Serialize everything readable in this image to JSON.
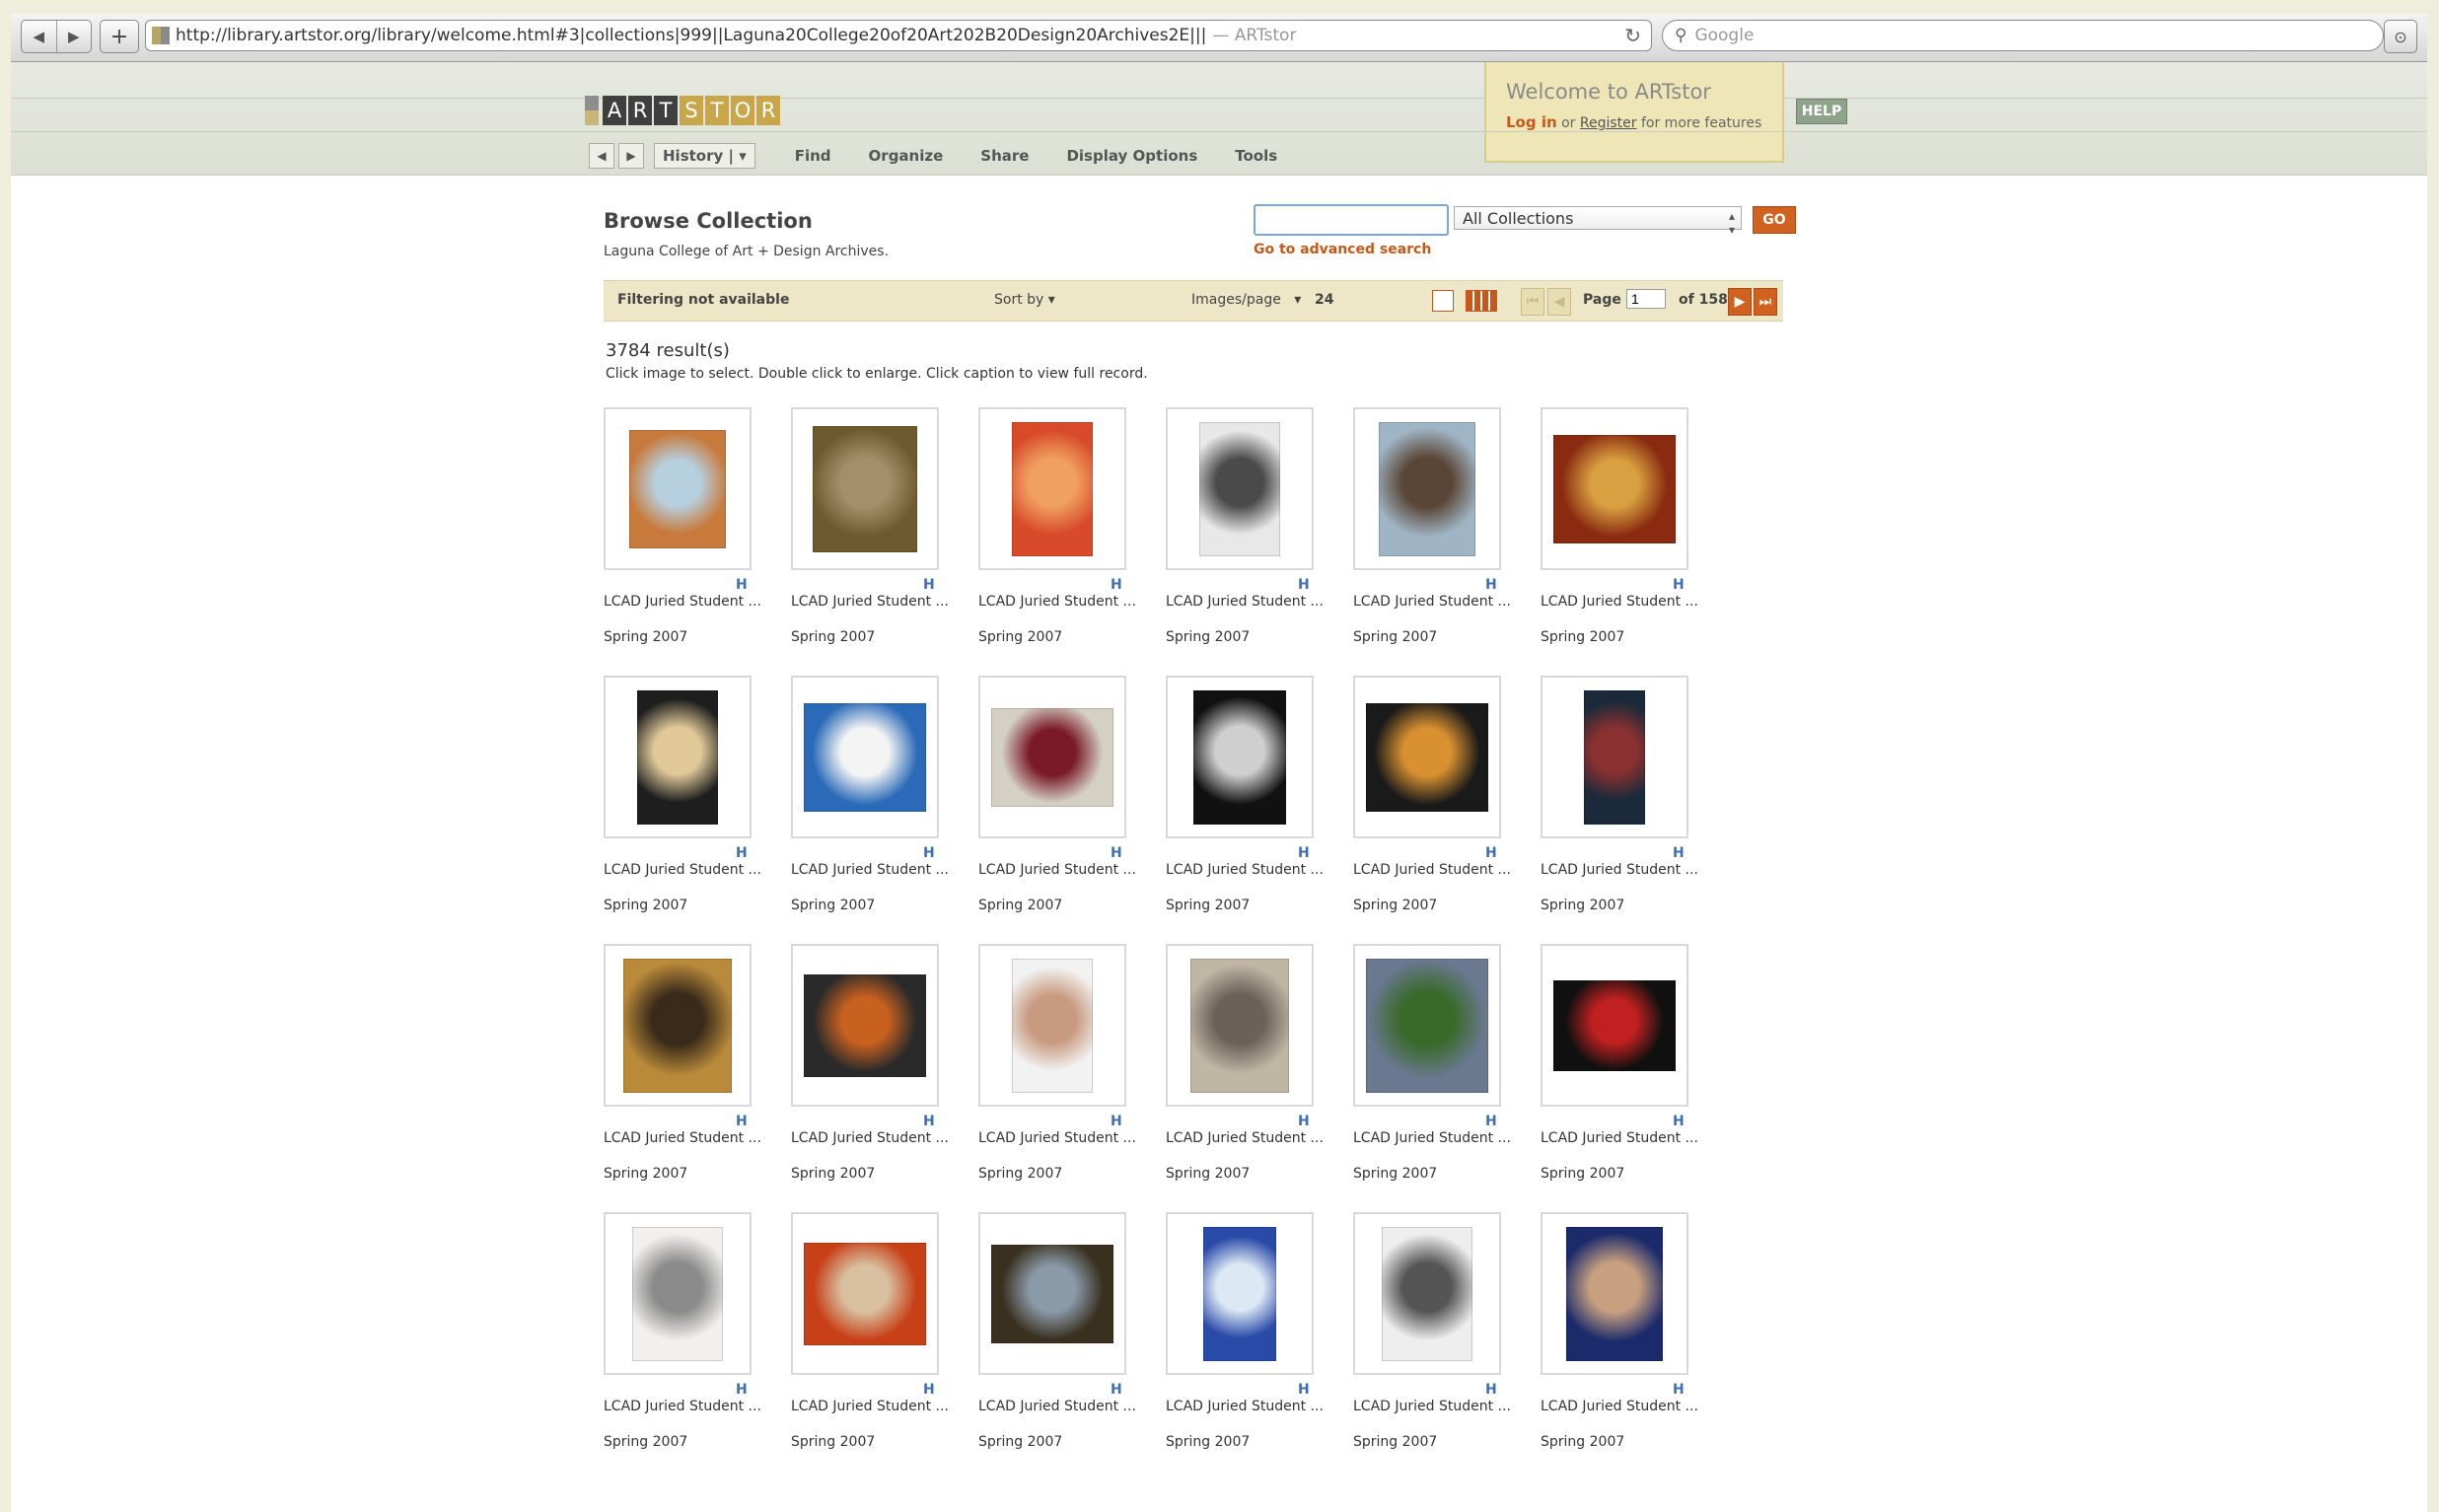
{
  "browser": {
    "url": "http://library.artstor.org/library/welcome.html#3|collections|999||Laguna20College20of20Art202B20Design20Archives2E|||",
    "page_title": "— ARTstor",
    "search_placeholder": "Google"
  },
  "header": {
    "logo_letters": [
      "A",
      "R",
      "T",
      "S",
      "T",
      "O",
      "R"
    ],
    "nav": {
      "history_label": "History",
      "menu": [
        "Find",
        "Organize",
        "Share",
        "Display Options",
        "Tools"
      ]
    },
    "welcome": {
      "title": "Welcome to ARTstor",
      "login": "Log in",
      "or": "or",
      "register": "Register",
      "suffix": "for more features"
    },
    "help_label": "HELP"
  },
  "browse": {
    "title": "Browse Collection",
    "subtitle": "Laguna College of Art + Design Archives.",
    "search": {
      "query": "",
      "collection": "All Collections",
      "go_label": "GO",
      "advanced_link": "Go to advanced search"
    }
  },
  "toolbar": {
    "filter": "Filtering not available",
    "sort_label": "Sort by",
    "ipp_label": "Images/page",
    "ipp_value": "24",
    "page_label": "Page",
    "page_value": "1",
    "of_label": "of 158"
  },
  "results": {
    "count": "3784 result(s)",
    "instructions": "Click image to select. Double click to enlarge. Click caption to view full record."
  },
  "items": [
    {
      "caption": "LCAD Juried Student ...",
      "date": "Spring 2007",
      "h": "H",
      "thumb": "framed-abstract",
      "colors": [
        "#c87a3c",
        "#b7d0e0"
      ]
    },
    {
      "caption": "LCAD Juried Student ...",
      "date": "Spring 2007",
      "h": "H",
      "thumb": "framed-portrait",
      "colors": [
        "#6e5a2e",
        "#a58f6a"
      ]
    },
    {
      "caption": "LCAD Juried Student ...",
      "date": "Spring 2007",
      "h": "H",
      "thumb": "red-abstract",
      "colors": [
        "#d84a2a",
        "#f0a060"
      ]
    },
    {
      "caption": "LCAD Juried Student ...",
      "date": "Spring 2007",
      "h": "H",
      "thumb": "sculpture-bird",
      "colors": [
        "#e8e8e8",
        "#4a4a4a"
      ]
    },
    {
      "caption": "LCAD Juried Student ...",
      "date": "Spring 2007",
      "h": "H",
      "thumb": "figures-blue",
      "colors": [
        "#9fb4c4",
        "#5a4636"
      ]
    },
    {
      "caption": "LCAD Juried Student ...",
      "date": "Spring 2007",
      "h": "H",
      "thumb": "still-life-m",
      "colors": [
        "#8a2a10",
        "#d8a040"
      ]
    },
    {
      "caption": "LCAD Juried Student ...",
      "date": "Spring 2007",
      "h": "H",
      "thumb": "dark-window",
      "colors": [
        "#1e1e1e",
        "#e0c898"
      ]
    },
    {
      "caption": "LCAD Juried Student ...",
      "date": "Spring 2007",
      "h": "H",
      "thumb": "white-building",
      "colors": [
        "#2a6ab8",
        "#f4f4f4"
      ]
    },
    {
      "caption": "LCAD Juried Student ...",
      "date": "Spring 2007",
      "h": "H",
      "thumb": "onion",
      "colors": [
        "#d4d0c4",
        "#7a1a26"
      ]
    },
    {
      "caption": "LCAD Juried Student ...",
      "date": "Spring 2007",
      "h": "H",
      "thumb": "pencil-portrait",
      "colors": [
        "#111111",
        "#cfcfcf"
      ]
    },
    {
      "caption": "LCAD Juried Student ...",
      "date": "Spring 2007",
      "h": "H",
      "thumb": "pear-mask",
      "colors": [
        "#1a1a1a",
        "#d89030"
      ]
    },
    {
      "caption": "LCAD Juried Student ...",
      "date": "Spring 2007",
      "h": "H",
      "thumb": "woman-dark",
      "colors": [
        "#1a2a3a",
        "#8a3030"
      ]
    },
    {
      "caption": "LCAD Juried Student ...",
      "date": "Spring 2007",
      "h": "H",
      "thumb": "gold-frame",
      "colors": [
        "#b88a3a",
        "#3a2a1a"
      ]
    },
    {
      "caption": "LCAD Juried Student ...",
      "date": "Spring 2007",
      "h": "H",
      "thumb": "pumpkin",
      "colors": [
        "#2a2a2a",
        "#c86020"
      ]
    },
    {
      "caption": "LCAD Juried Student ...",
      "date": "Spring 2007",
      "h": "H",
      "thumb": "bust",
      "colors": [
        "#f2f2f2",
        "#c89a80"
      ]
    },
    {
      "caption": "LCAD Juried Student ...",
      "date": "Spring 2007",
      "h": "H",
      "thumb": "skull",
      "colors": [
        "#bfb6a4",
        "#6a6258"
      ]
    },
    {
      "caption": "LCAD Juried Student ...",
      "date": "Spring 2007",
      "h": "H",
      "thumb": "street",
      "colors": [
        "#6a7890",
        "#3a6a2a"
      ]
    },
    {
      "caption": "LCAD Juried Student ...",
      "date": "Spring 2007",
      "h": "H",
      "thumb": "collage",
      "colors": [
        "#101010",
        "#c02020"
      ]
    },
    {
      "caption": "LCAD Juried Student ...",
      "date": "Spring 2007",
      "h": "H",
      "thumb": "sketch-figure",
      "colors": [
        "#f2f0ec",
        "#8a8a8a"
      ]
    },
    {
      "caption": "LCAD Juried Student ...",
      "date": "Spring 2007",
      "h": "H",
      "thumb": "woman-red",
      "colors": [
        "#c84018",
        "#d8c0a0"
      ]
    },
    {
      "caption": "LCAD Juried Student ...",
      "date": "Spring 2007",
      "h": "H",
      "thumb": "raft",
      "colors": [
        "#3a3020",
        "#8a9aa8"
      ]
    },
    {
      "caption": "LCAD Juried Student ...",
      "date": "Spring 2007",
      "h": "H",
      "thumb": "blue-figure",
      "colors": [
        "#2a4aa8",
        "#dce8f4"
      ]
    },
    {
      "caption": "LCAD Juried Student ...",
      "date": "Spring 2007",
      "h": "H",
      "thumb": "ink-drawing",
      "colors": [
        "#eeeeee",
        "#555555"
      ]
    },
    {
      "caption": "LCAD Juried Student ...",
      "date": "Spring 2007",
      "h": "H",
      "thumb": "oval-mosaic",
      "colors": [
        "#1a2a6a",
        "#c8a080"
      ]
    }
  ]
}
